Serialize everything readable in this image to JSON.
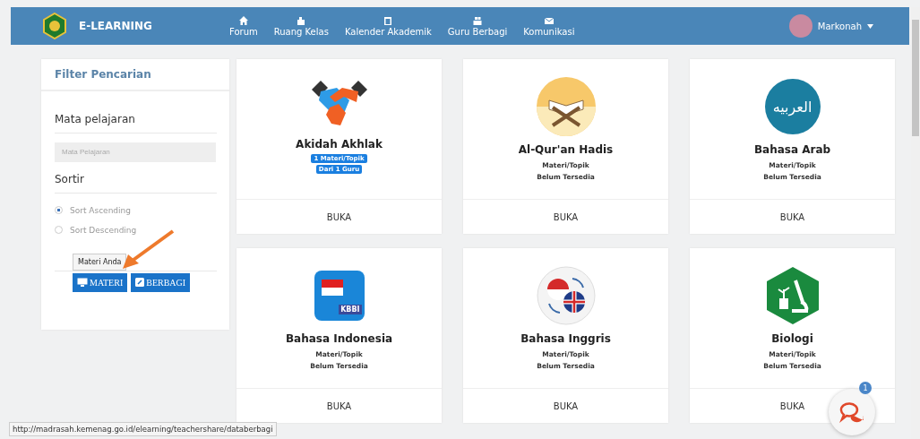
{
  "navbar": {
    "brand": "E-LEARNING",
    "items": [
      {
        "label": "Forum"
      },
      {
        "label": "Ruang Kelas"
      },
      {
        "label": "Kalender Akademik"
      },
      {
        "label": "Guru Berbagi"
      },
      {
        "label": "Komunikasi"
      }
    ],
    "user": {
      "name": "Markonah"
    }
  },
  "filter": {
    "title": "Filter Pencarian",
    "subject_label": "Mata pelajaran",
    "subject_placeholder": "Mata Pelajaran",
    "sort_label": "Sortir",
    "sort_options": [
      {
        "label": "Sort Ascending",
        "selected": true
      },
      {
        "label": "Sort Descending",
        "selected": false
      }
    ],
    "tooltip": "Materi Anda",
    "buttons": [
      {
        "label": "MATERI"
      },
      {
        "label": "BERBAGI"
      }
    ]
  },
  "cards": [
    {
      "title": "Akidah Akhlak",
      "kind": "badges",
      "lines": [
        "1 Materi/Topik",
        "Dari 1 Guru"
      ],
      "button": "BUKA"
    },
    {
      "title": "Al-Qur'an Hadis",
      "kind": "note",
      "lines": [
        "Materi/Topik",
        "Belum Tersedia"
      ],
      "button": "BUKA"
    },
    {
      "title": "Bahasa Arab",
      "kind": "note",
      "icon_text": "العربيه",
      "lines": [
        "Materi/Topik",
        "Belum Tersedia"
      ],
      "button": "BUKA"
    },
    {
      "title": "Bahasa Indonesia",
      "kind": "note",
      "icon_text": "KBBI",
      "lines": [
        "Materi/Topik",
        "Belum Tersedia"
      ],
      "button": "BUKA"
    },
    {
      "title": "Bahasa Inggris",
      "kind": "note",
      "lines": [
        "Materi/Topik",
        "Belum Tersedia"
      ],
      "button": "BUKA"
    },
    {
      "title": "Biologi",
      "kind": "note",
      "lines": [
        "Materi/Topik",
        "Belum Tersedia"
      ],
      "button": "BUKA"
    }
  ],
  "chat": {
    "badge": "1"
  },
  "status_url": "http://madrasah.kemenag.go.id/elearning/teachershare/databerbagi"
}
